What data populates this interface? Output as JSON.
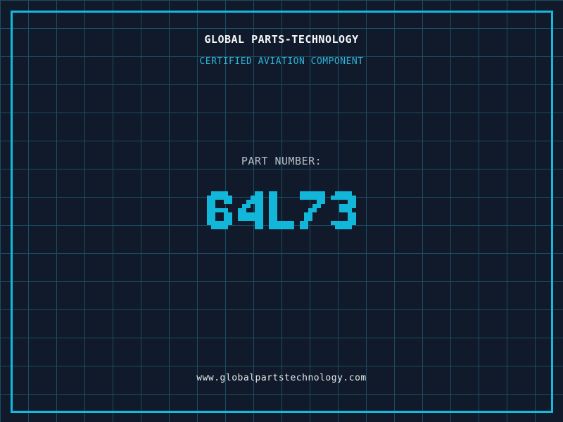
{
  "header": {
    "title": "GLOBAL PARTS-TECHNOLOGY",
    "subtitle": "CERTIFIED AVIATION COMPONENT"
  },
  "part": {
    "label": "PART NUMBER:",
    "value": "64L73"
  },
  "footer": {
    "url": "www.globalpartstechnology.com"
  },
  "colors": {
    "background": "#101a2a",
    "grid_line": "#1c4d63",
    "frame": "#14b9e0",
    "accent_cyan": "#11b6d9",
    "subtitle_text": "#2eb6d9",
    "title_text": "#f6f8fa",
    "label_text": "#b7c0c9",
    "footer_text": "#e4e8ec"
  }
}
